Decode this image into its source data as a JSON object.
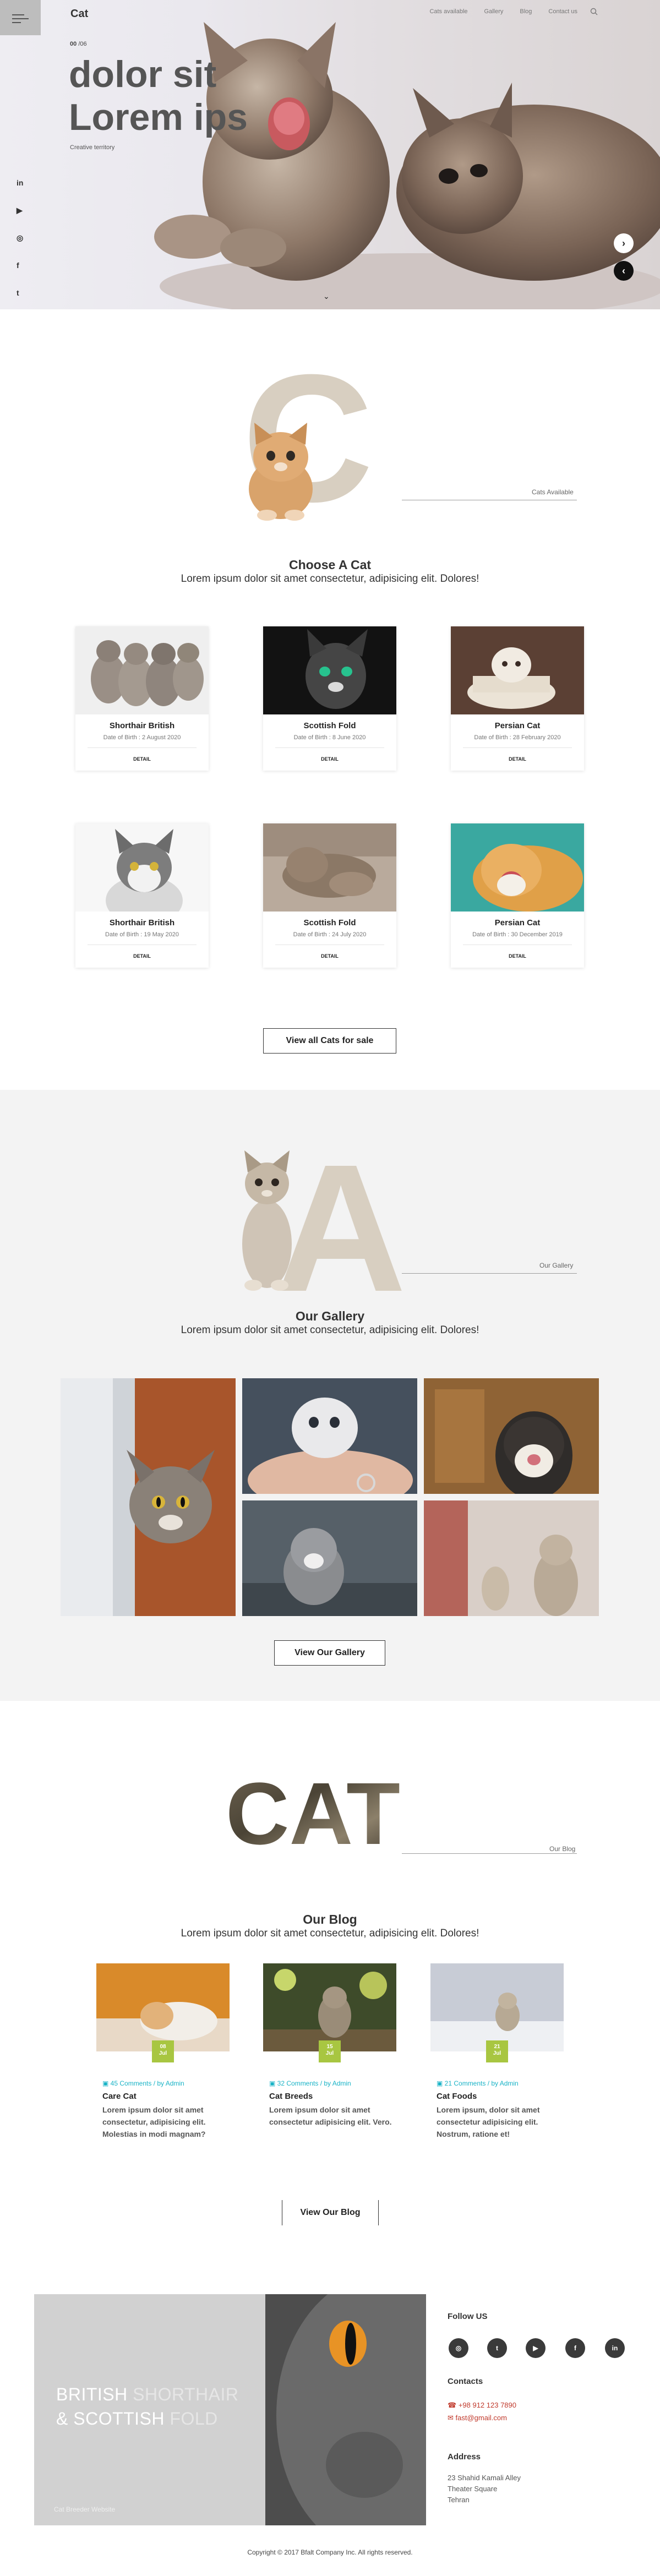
{
  "header": {
    "logo": "Cat",
    "nav": [
      "Cats available",
      "Gallery",
      "Blog",
      "Contact us"
    ]
  },
  "hero": {
    "slide_counter": "00",
    "slide_counter_sub": "/06",
    "title_line1": "dolor sit",
    "title_line2": "Lorem ips",
    "credit": "Creative territory",
    "social": [
      "in",
      "▶",
      "◎",
      "f",
      "t"
    ]
  },
  "cats": {
    "big_letter": "C",
    "deco_label": "Cats Available",
    "title": "Choose A Cat",
    "description": "Lorem ipsum dolor sit amet consectetur, adipisicing elit. Dolores!",
    "items": [
      {
        "name": "Shorthair British",
        "dob": "Date of Birth : 2 August 2020",
        "detail": "DETAIL"
      },
      {
        "name": "Scottish Fold",
        "dob": "Date of Birth : 8 June 2020",
        "detail": "DETAIL"
      },
      {
        "name": "Persian Cat",
        "dob": "Date of Birth : 28 February 2020",
        "detail": "DETAIL"
      },
      {
        "name": "Shorthair British",
        "dob": "Date of Birth : 19 May 2020",
        "detail": "DETAIL"
      },
      {
        "name": "Scottish Fold",
        "dob": "Date of Birth : 24 July 2020",
        "detail": "DETAIL"
      },
      {
        "name": "Persian Cat",
        "dob": "Date of Birth : 30 December 2019",
        "detail": "DETAIL"
      }
    ],
    "view_all_label": "View all Cats for sale"
  },
  "gallery": {
    "big_letter": "A",
    "deco_label": "Our Gallery",
    "title": "Our Gallery",
    "description": "Lorem ipsum dolor sit amet consectetur, adipisicing elit. Dolores!",
    "button_label": "View Our Gallery"
  },
  "blog": {
    "big_word": "CAT",
    "deco_label": "Our Blog",
    "title": "Our Blog",
    "description": "Lorem ipsum dolor sit amet consectetur, adipisicing elit. Dolores!",
    "posts": [
      {
        "date_day": "08",
        "date_month": "Jul",
        "meta": "45 Comments / by Admin",
        "title": "Care Cat",
        "text": "Lorem ipsum dolor sit amet consectetur, adipisicing elit. Molestias in modi magnam?"
      },
      {
        "date_day": "15",
        "date_month": "Jul",
        "meta": "32 Comments / by Admin",
        "title": "Cat Breeds",
        "text": "Lorem ipsum dolor sit amet consectetur adipisicing elit. Vero."
      },
      {
        "date_day": "21",
        "date_month": "Jul",
        "meta": "21 Comments / by Admin",
        "title": "Cat Foods",
        "text": "Lorem ipsum, dolor sit amet consectetur adipisicing elit. Nostrum, ratione et!"
      }
    ],
    "button_label": "View Our Blog"
  },
  "footer": {
    "banner_line1_a": "BRITISH ",
    "banner_line1_b": "SHORTHAIR",
    "banner_line2_a": "& SCOTTISH ",
    "banner_line2_b": "FOLD",
    "banner_sub": "Cat Breeder Website",
    "follow_title": "Follow US",
    "social": [
      "◎",
      "t",
      "▶",
      "f",
      "in"
    ],
    "contacts_title": "Contacts",
    "phone": "+98 912 123 7890",
    "email": "fast@gmail.com",
    "address_title": "Address",
    "address_lines": [
      "23 Shahid Kamali Alley",
      "Theater Square",
      "Tehran"
    ],
    "copyright": "Copyright © 2017 Bfalt Company Inc. All rights reserved."
  },
  "colors": {
    "accent_beige": "#d8cfc1",
    "badge_green": "#a8c641",
    "meta_cyan": "#19b3c6",
    "contact_red": "#c0392b"
  }
}
